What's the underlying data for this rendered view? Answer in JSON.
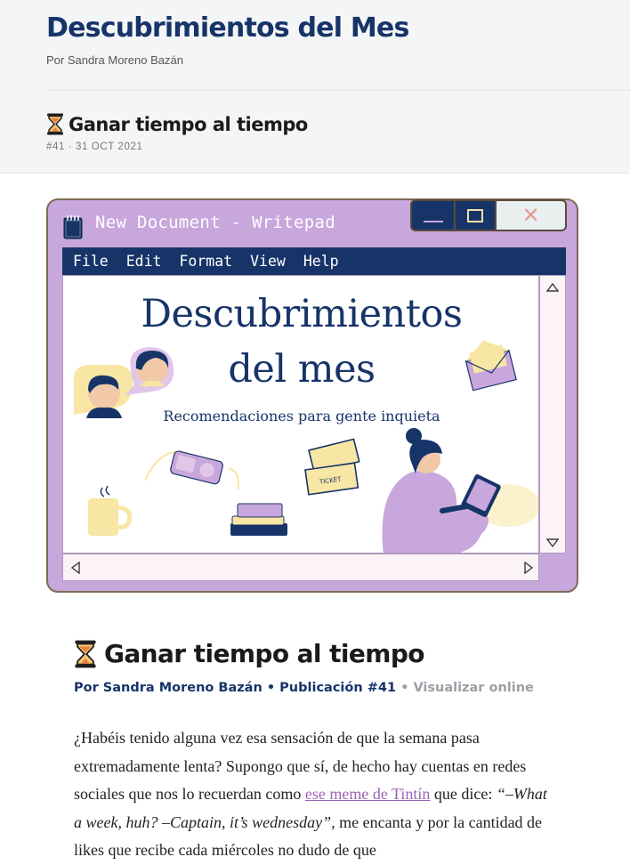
{
  "site": {
    "title": "Descubrimientos del Mes",
    "author": "Por Sandra Moreno Bazán"
  },
  "issue": {
    "title": "Ganar tiempo al tiempo",
    "meta": "#41 · 31 OCT 2021",
    "icon": "hourglass-icon"
  },
  "banner": {
    "window_title": "New Document - Writepad",
    "menu": [
      "File",
      "Edit",
      "Format",
      "View",
      "Help"
    ],
    "heading_line1": "Descubrimientos",
    "heading_line2": "del mes",
    "subheading": "Recomendaciones para gente inquieta",
    "ticket_label": "TICKET",
    "colors": {
      "window": "#c8a7dc",
      "navy": "#173469",
      "cream": "#f2e0a2"
    }
  },
  "article": {
    "title": "Ganar tiempo al tiempo",
    "byline_author": "Por Sandra Moreno Bazán",
    "byline_sep1": " • ",
    "byline_issue": "Publicación #41",
    "byline_sep2": " • ",
    "byline_online": "Visualizar online",
    "para_1": "¿Habéis tenido alguna vez esa sensación de que la semana pasa extremadamente lenta? Supongo que sí, de hecho hay cuentas en redes sociales que nos lo recuerdan como ",
    "para_link": "ese meme de Tintín",
    "para_2": " que dice: ",
    "para_quote": "“–What a week, huh? –Captain, it’s wednesday”,",
    "para_3": " me encanta y por la cantidad de likes que recibe cada miércoles no dudo de que"
  }
}
